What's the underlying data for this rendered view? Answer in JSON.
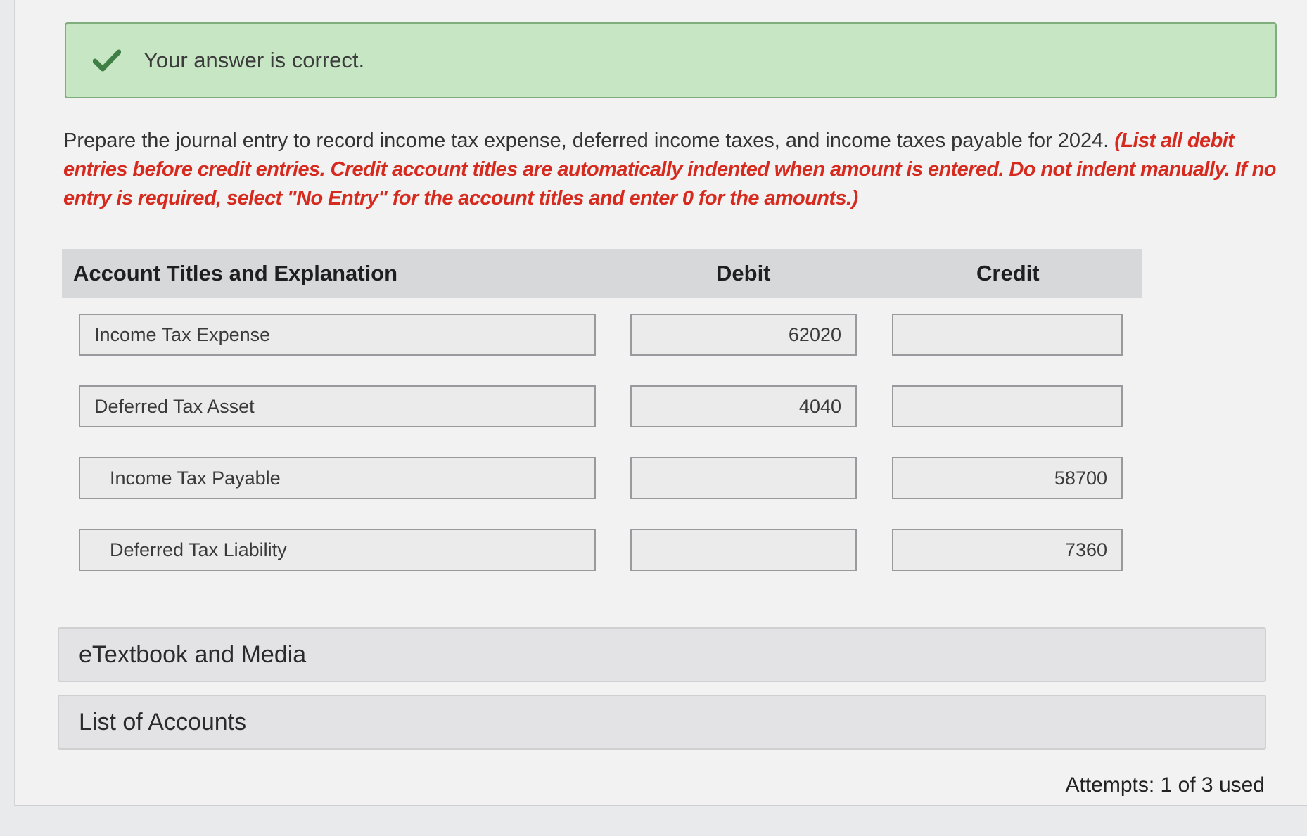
{
  "feedback": {
    "message": "Your answer is correct.",
    "icon": "check-icon",
    "color": "#3f7f45"
  },
  "instructions": {
    "prompt": "Prepare the journal entry to record income tax expense, deferred income taxes, and income taxes payable for 2024.",
    "note": "(List all debit entries before credit entries. Credit account titles are automatically indented when amount is entered. Do not indent manually. If no entry is required, select \"No Entry\" for the account titles and enter 0 for the amounts.)",
    "note_color": "#d62a1e"
  },
  "table": {
    "headers": {
      "account": "Account Titles and Explanation",
      "debit": "Debit",
      "credit": "Credit"
    },
    "rows": [
      {
        "account": "Income Tax Expense",
        "debit": "62020",
        "credit": ""
      },
      {
        "account": "Deferred Tax Asset",
        "debit": "4040",
        "credit": ""
      },
      {
        "account": "Income Tax Payable",
        "debit": "",
        "credit": "58700"
      },
      {
        "account": "Deferred Tax Liability",
        "debit": "",
        "credit": "7360"
      }
    ]
  },
  "sections": {
    "etextbook": "eTextbook and Media",
    "accounts": "List of Accounts"
  },
  "attempts": "Attempts: 1 of 3 used"
}
